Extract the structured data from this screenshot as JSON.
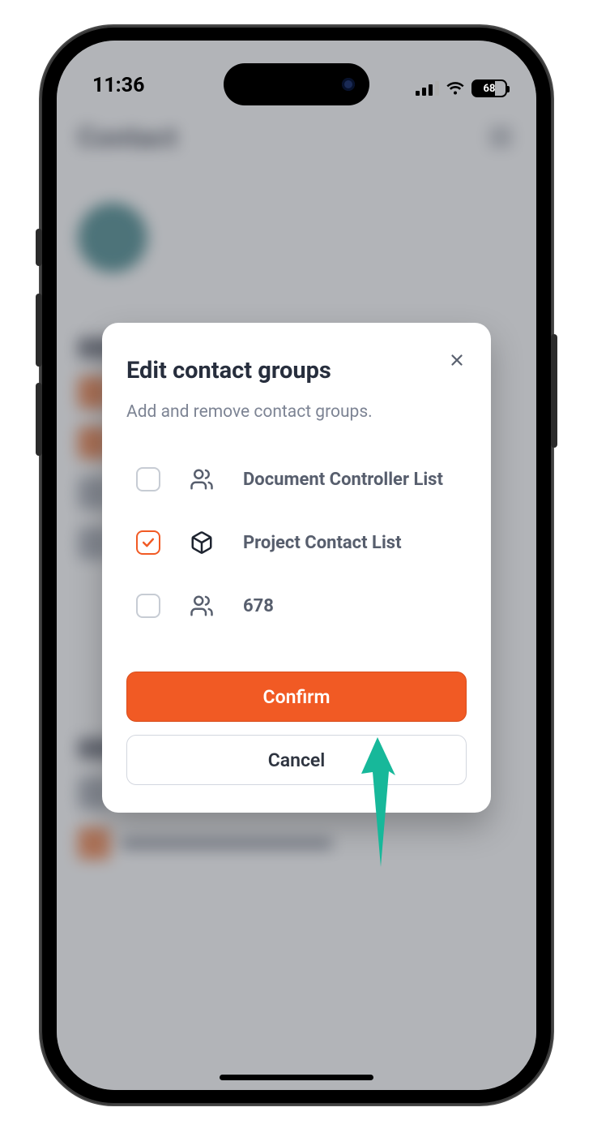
{
  "status": {
    "time": "11:36",
    "battery": "68"
  },
  "modal": {
    "title": "Edit contact groups",
    "subtitle": "Add and remove contact groups.",
    "groups": [
      {
        "label": "Document Controller List",
        "checked": false,
        "iconType": "people"
      },
      {
        "label": "Project Contact List",
        "checked": true,
        "iconType": "cube"
      },
      {
        "label": "678",
        "checked": false,
        "iconType": "people"
      }
    ],
    "confirm": "Confirm",
    "cancel": "Cancel"
  },
  "colors": {
    "accent": "#f15a24",
    "arrow": "#17b89a"
  }
}
